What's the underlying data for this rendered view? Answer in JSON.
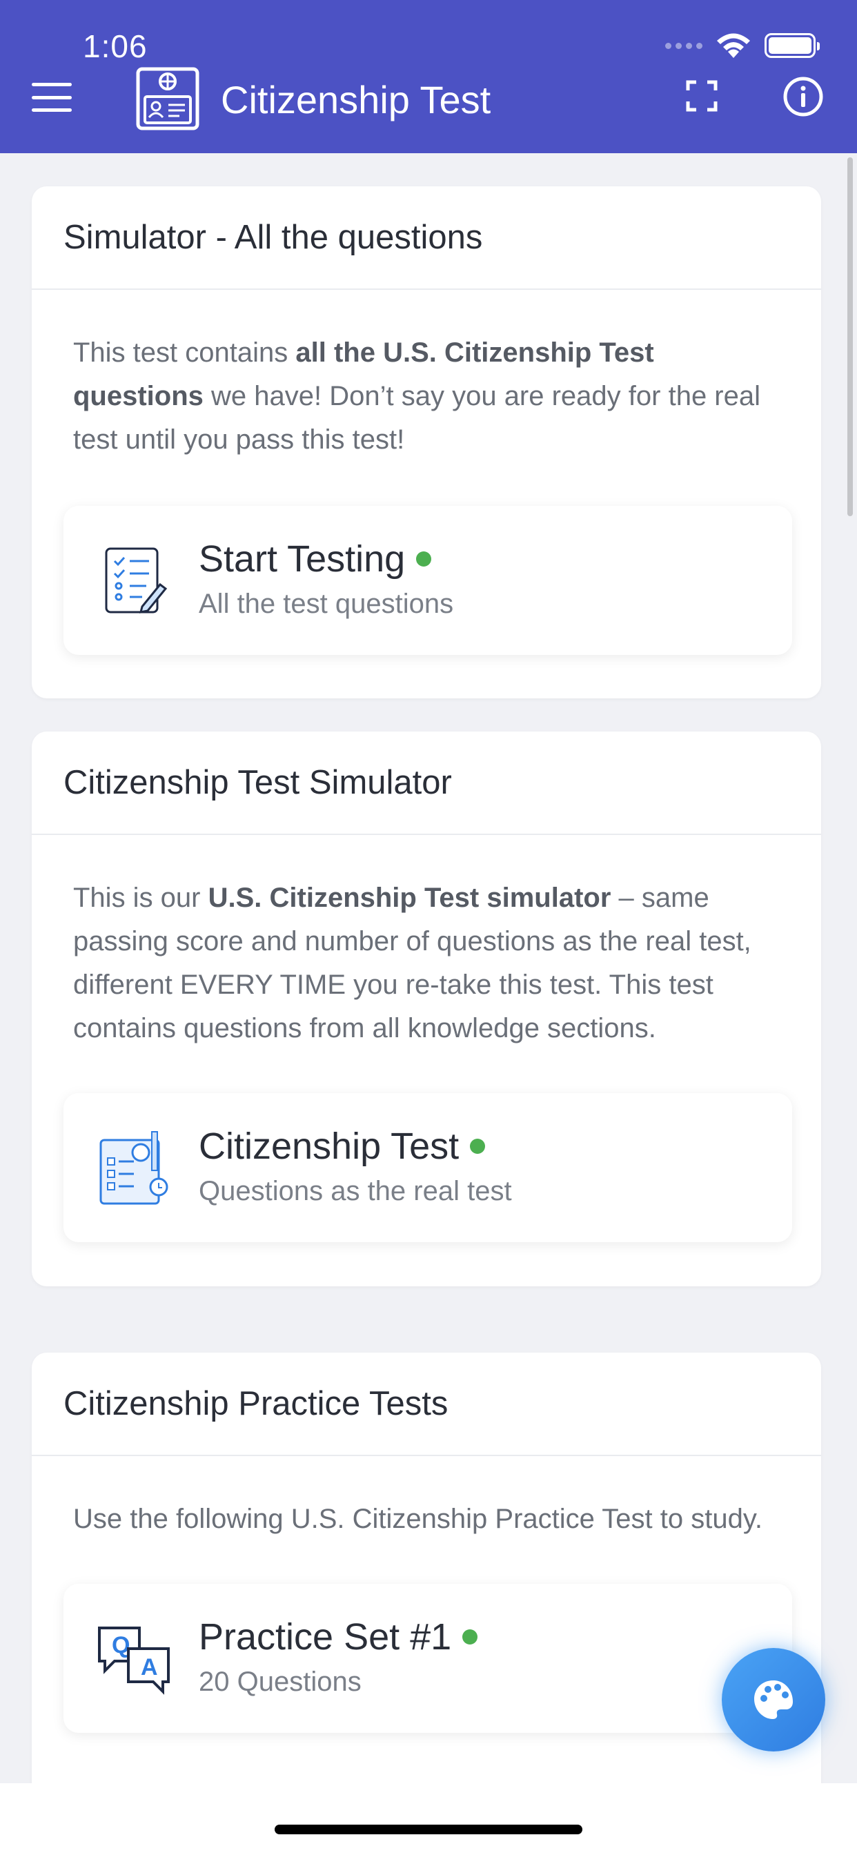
{
  "status_bar": {
    "time": "1:06"
  },
  "header": {
    "title": "Citizenship Test"
  },
  "sections": [
    {
      "title": "Simulator - All the questions",
      "description": [
        {
          "text": "This test contains ",
          "bold": false
        },
        {
          "text": "all the U.S. Citizenship Test questions",
          "bold": true
        },
        {
          "text": " we have! Don’t say you are ready for the real test until you pass this test!",
          "bold": false
        }
      ],
      "item": {
        "name": "Start Testing",
        "subtitle": "All the test questions",
        "icon": "checklist-icon"
      }
    },
    {
      "title": "Citizenship Test Simulator",
      "description": [
        {
          "text": "This is our ",
          "bold": false
        },
        {
          "text": "U.S. Citizenship Test simulator",
          "bold": true
        },
        {
          "text": " – same passing score and number of questions as the real test, different EVERY TIME you re-take this test. This test contains questions from all knowledge sections.",
          "bold": false
        }
      ],
      "item": {
        "name": "Citizenship Test",
        "subtitle": "Questions as the real test",
        "icon": "exam-sheet-icon"
      }
    },
    {
      "title": "Citizenship Practice Tests",
      "description": [
        {
          "text": "Use the following U.S. Citizenship Practice Test to study.",
          "bold": false
        }
      ],
      "item": {
        "name": "Practice Set #1",
        "subtitle": "20 Questions",
        "icon": "qa-icon"
      }
    }
  ],
  "fab": {
    "icon": "palette-icon"
  },
  "colors": {
    "header": "#4c52c4",
    "dot": "#4caf50",
    "fab": "#3a8fea"
  }
}
